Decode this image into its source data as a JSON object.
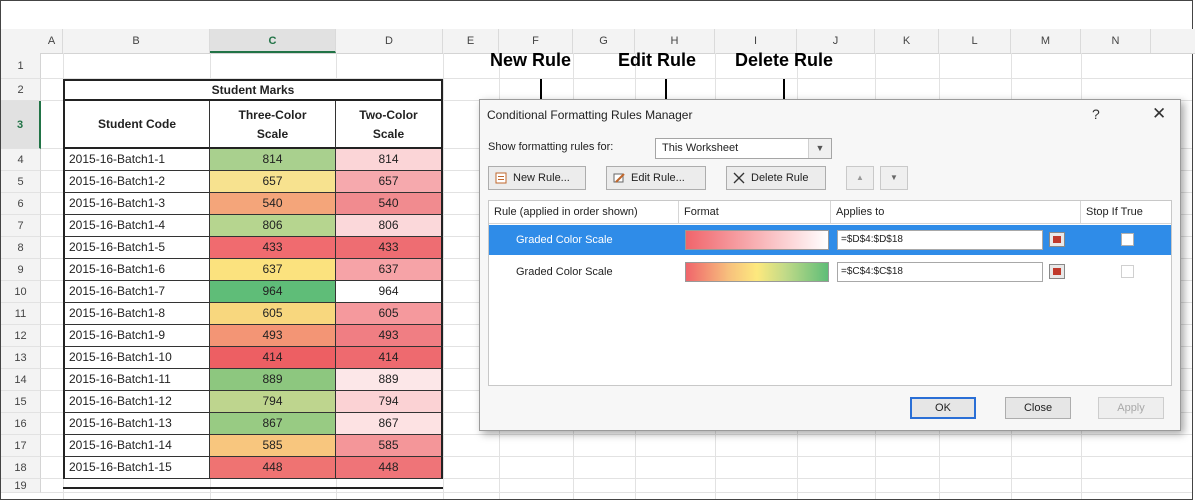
{
  "sheet": {
    "columns": [
      "A",
      "B",
      "C",
      "D",
      "E",
      "F",
      "G",
      "H",
      "I",
      "J",
      "K",
      "L",
      "M",
      "N"
    ],
    "active_column": "C",
    "rows": [
      "1",
      "2",
      "3",
      "4",
      "5",
      "6",
      "7",
      "8",
      "9",
      "10",
      "11",
      "12",
      "13",
      "14",
      "15",
      "16",
      "17",
      "18",
      "19"
    ],
    "active_row": "3"
  },
  "table": {
    "title": "Student Marks",
    "headers": {
      "code": "Student Code",
      "three_color": [
        "Three-Color",
        "Scale"
      ],
      "two_color": [
        "Two-Color",
        "Scale"
      ]
    },
    "rows": [
      {
        "code": "2015-16-Batch1-1",
        "c3": "814",
        "c2": "814",
        "c3_color": "#a9d08e",
        "c2_color": "#fbd5d7"
      },
      {
        "code": "2015-16-Batch1-2",
        "c3": "657",
        "c2": "657",
        "c3_color": "#f7e28f",
        "c2_color": "#f6a9ad"
      },
      {
        "code": "2015-16-Batch1-3",
        "c3": "540",
        "c2": "540",
        "c3_color": "#f4a57a",
        "c2_color": "#f18b8f"
      },
      {
        "code": "2015-16-Batch1-4",
        "c3": "806",
        "c2": "806",
        "c3_color": "#b6d58f",
        "c2_color": "#fbd8da"
      },
      {
        "code": "2015-16-Batch1-5",
        "c3": "433",
        "c2": "433",
        "c3_color": "#f06b6f",
        "c2_color": "#ee6d72"
      },
      {
        "code": "2015-16-Batch1-6",
        "c3": "637",
        "c2": "637",
        "c3_color": "#fbe27e",
        "c2_color": "#f6a3a7"
      },
      {
        "code": "2015-16-Batch1-7",
        "c3": "964",
        "c2": "964",
        "c3_color": "#5fbd78",
        "c2_color": "#ffffff"
      },
      {
        "code": "2015-16-Batch1-8",
        "c3": "605",
        "c2": "605",
        "c3_color": "#f8d77e",
        "c2_color": "#f5999d"
      },
      {
        "code": "2015-16-Batch1-9",
        "c3": "493",
        "c2": "493",
        "c3_color": "#f39575",
        "c2_color": "#f07e83"
      },
      {
        "code": "2015-16-Batch1-10",
        "c3": "414",
        "c2": "414",
        "c3_color": "#ed5f63",
        "c2_color": "#ee6a6f"
      },
      {
        "code": "2015-16-Batch1-11",
        "c3": "889",
        "c2": "889",
        "c3_color": "#8dc77f",
        "c2_color": "#fce7e8"
      },
      {
        "code": "2015-16-Batch1-12",
        "c3": "794",
        "c2": "794",
        "c3_color": "#bed58e",
        "c2_color": "#fbd2d4"
      },
      {
        "code": "2015-16-Batch1-13",
        "c3": "867",
        "c2": "867",
        "c3_color": "#98cb83",
        "c2_color": "#fde2e3"
      },
      {
        "code": "2015-16-Batch1-14",
        "c3": "585",
        "c2": "585",
        "c3_color": "#f8c67e",
        "c2_color": "#f49699"
      },
      {
        "code": "2015-16-Batch1-15",
        "c3": "448",
        "c2": "448",
        "c3_color": "#ef7372",
        "c2_color": "#ef7478"
      }
    ]
  },
  "annotations": {
    "new_rule": "New Rule",
    "edit_rule": "Edit Rule",
    "delete_rule": "Delete Rule"
  },
  "dialog": {
    "title": "Conditional Formatting Rules Manager",
    "help": "?",
    "close": "✕",
    "show_label": "Show formatting rules for:",
    "scope_value": "This Worksheet",
    "buttons": {
      "new_rule": "New Rule...",
      "edit_rule": "Edit Rule...",
      "delete_rule": "Delete Rule",
      "move_up": "▲",
      "move_down": "▼"
    },
    "columns": {
      "rule": "Rule (applied in order shown)",
      "format": "Format",
      "applies_to": "Applies to",
      "stop_if_true": "Stop If True"
    },
    "rules": [
      {
        "name": "Graded Color Scale",
        "applies_to": "=$D$4:$D$18",
        "selected": true
      },
      {
        "name": "Graded Color Scale",
        "applies_to": "=$C$4:$C$18",
        "selected": false
      }
    ],
    "ok": "OK",
    "close_btn": "Close",
    "apply": "Apply"
  },
  "colors": {
    "accent": "#217346",
    "selection": "#2f8ce8"
  }
}
